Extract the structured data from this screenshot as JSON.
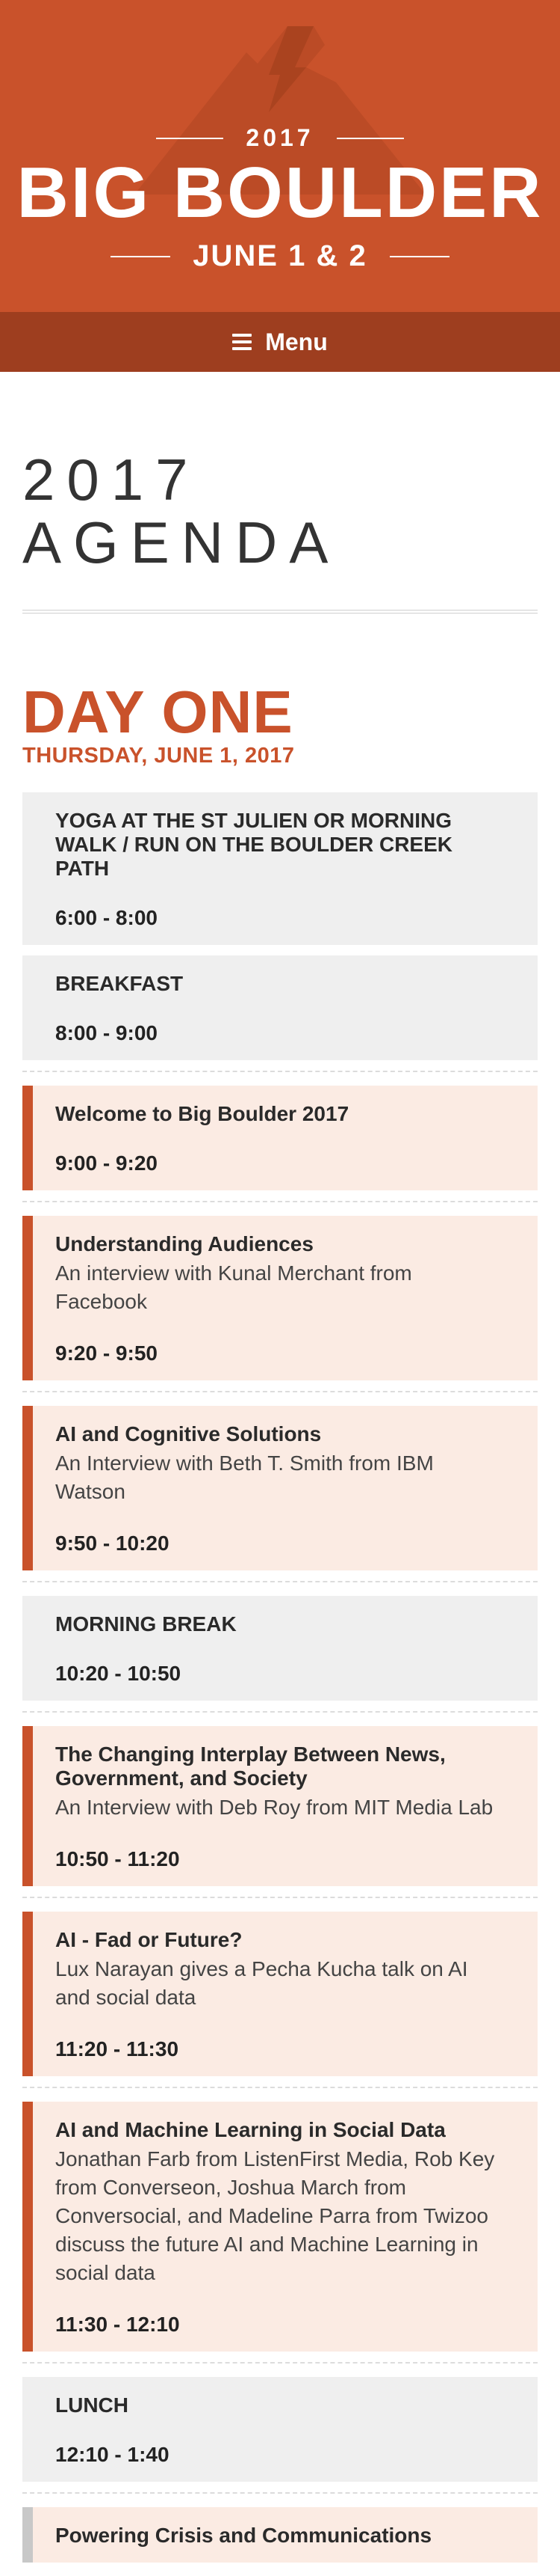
{
  "header": {
    "year": "2017",
    "title": "BIG BOULDER",
    "dates": "JUNE 1 & 2"
  },
  "menu": {
    "label": "Menu",
    "icon": "hamburger-icon"
  },
  "page": {
    "title_line1": "2017",
    "title_line2": "AGENDA"
  },
  "day": {
    "name": "DAY ONE",
    "date": "THURSDAY, JUNE 1, 2017"
  },
  "colors": {
    "brand": "#c9522b",
    "brand_dark": "#9e3e1f",
    "session_bg": "#fbebe3",
    "gray_bg": "#efefef"
  },
  "sessions": [
    {
      "title": "YOGA AT THE ST JULIEN OR MORNING WALK / RUN ON THE BOULDER CREEK PATH",
      "desc": "",
      "time": "6:00 - 8:00"
    },
    {
      "title": "BREAKFAST",
      "desc": "",
      "time": "8:00 - 9:00"
    },
    {
      "title": "Welcome to Big Boulder 2017",
      "desc": "",
      "time": "9:00 - 9:20"
    },
    {
      "title": "Understanding Audiences",
      "desc": "An interview with Kunal Merchant from Facebook",
      "time": "9:20 - 9:50"
    },
    {
      "title": "AI and Cognitive Solutions",
      "desc": "An Interview with Beth T. Smith from IBM Watson",
      "time": "9:50 - 10:20"
    },
    {
      "title": "MORNING BREAK",
      "desc": "",
      "time": "10:20 - 10:50"
    },
    {
      "title": "The Changing Interplay Between News, Government, and Society",
      "desc": "An Interview with Deb Roy from MIT Media Lab",
      "time": "10:50 - 11:20"
    },
    {
      "title": "AI - Fad or Future?",
      "desc": "Lux Narayan gives a Pecha Kucha talk on AI and social data",
      "time": "11:20 - 11:30"
    },
    {
      "title": "AI and Machine Learning in Social Data",
      "desc": "Jonathan Farb from ListenFirst Media, Rob Key from Converseon, Joshua March from Conversocial, and Madeline Parra from Twizoo discuss the future AI and Machine Learning in social data",
      "time": "11:30 - 12:10"
    },
    {
      "title": "LUNCH",
      "desc": "",
      "time": "12:10 - 1:40"
    },
    {
      "title": "Powering Crisis and Communications",
      "desc": "",
      "time": ""
    }
  ]
}
